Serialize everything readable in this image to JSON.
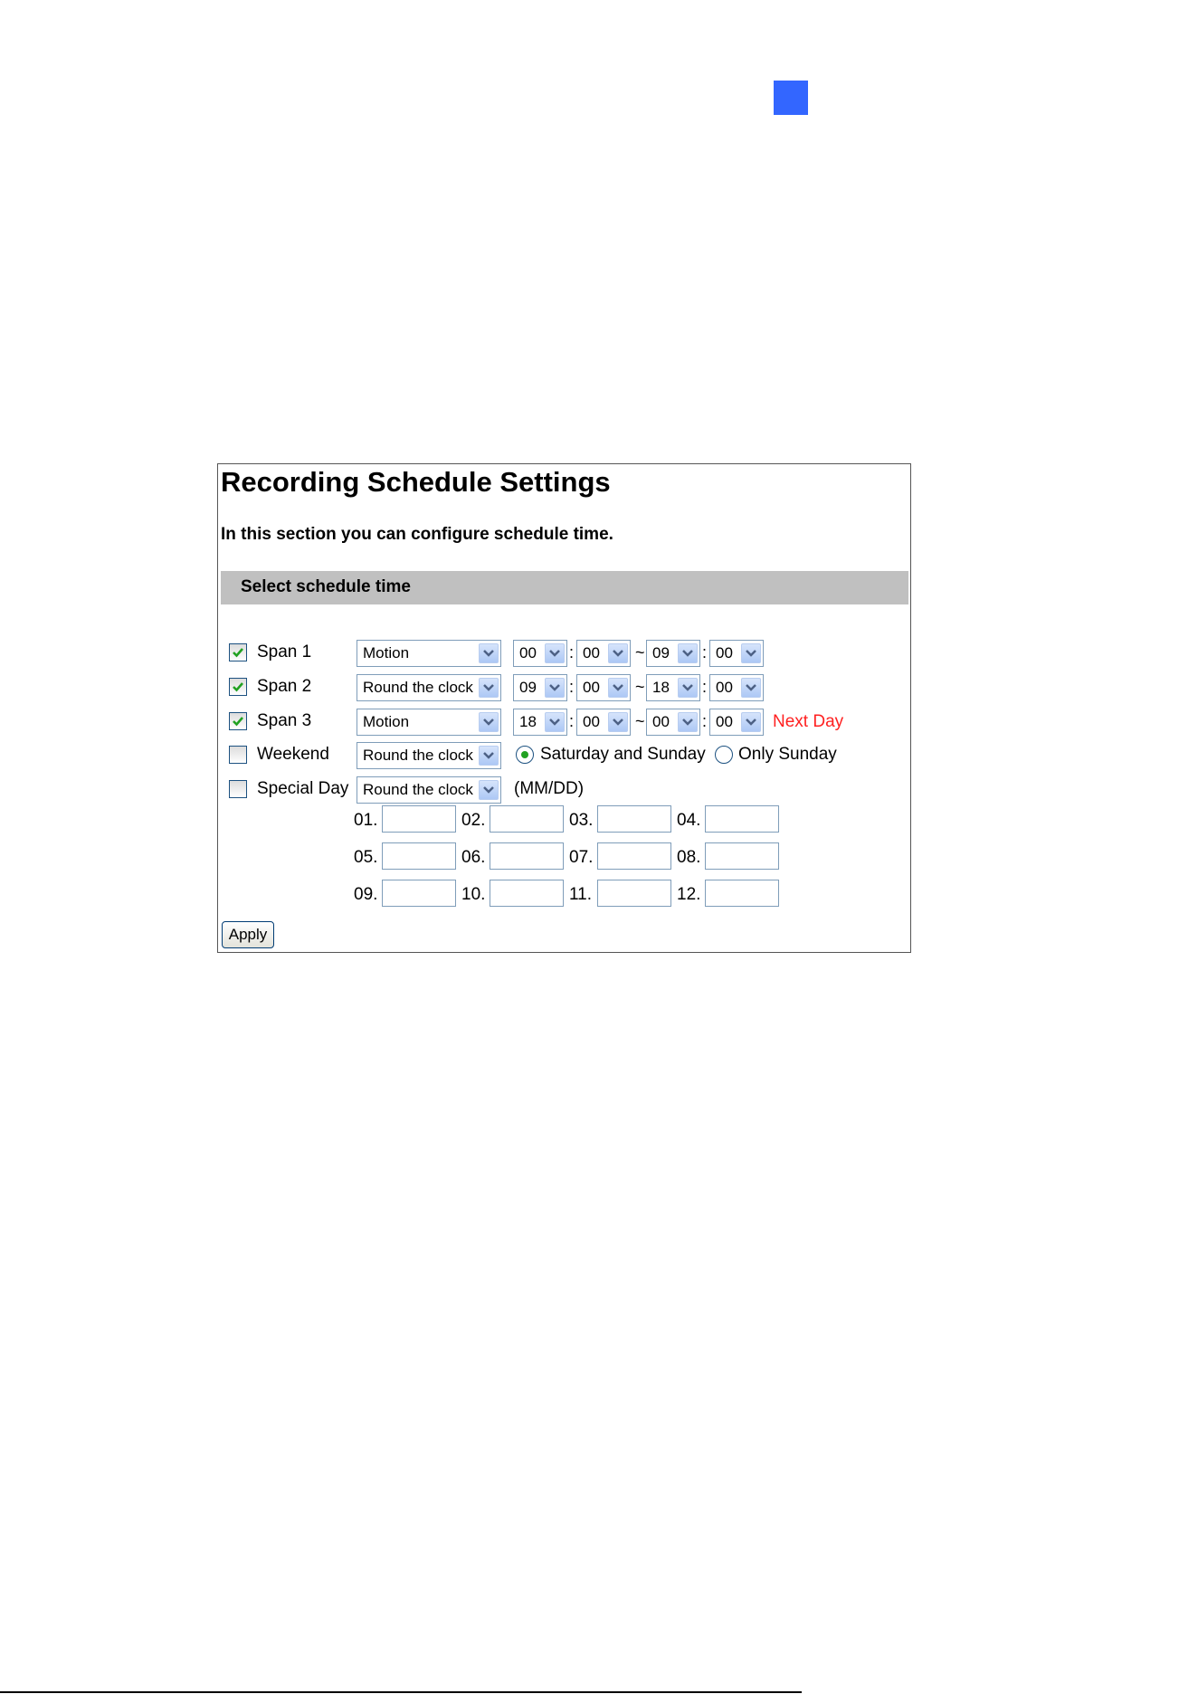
{
  "panel": {
    "title": "Recording Schedule Settings",
    "description": "In this section you can configure schedule time.",
    "section_header": "Select schedule time"
  },
  "spans": [
    {
      "label": "Span 1",
      "checked": true,
      "mode": "Motion",
      "start_h": "00",
      "start_m": "00",
      "end_h": "09",
      "end_m": "00",
      "note": ""
    },
    {
      "label": "Span 2",
      "checked": true,
      "mode": "Round the clock",
      "start_h": "09",
      "start_m": "00",
      "end_h": "18",
      "end_m": "00",
      "note": ""
    },
    {
      "label": "Span 3",
      "checked": true,
      "mode": "Motion",
      "start_h": "18",
      "start_m": "00",
      "end_h": "00",
      "end_m": "00",
      "note": "Next Day"
    }
  ],
  "separators": {
    "colon": ":",
    "tilde": "~"
  },
  "weekend": {
    "label": "Weekend",
    "checked": false,
    "mode": "Round the clock",
    "options": [
      "Saturday and Sunday",
      "Only Sunday"
    ],
    "selected": "Saturday and Sunday"
  },
  "special_day": {
    "label": "Special Day",
    "checked": false,
    "mode": "Round the clock",
    "format_hint": "(MM/DD)",
    "dates": [
      {
        "num": "01.",
        "value": ""
      },
      {
        "num": "02.",
        "value": ""
      },
      {
        "num": "03.",
        "value": ""
      },
      {
        "num": "04.",
        "value": ""
      },
      {
        "num": "05.",
        "value": ""
      },
      {
        "num": "06.",
        "value": ""
      },
      {
        "num": "07.",
        "value": ""
      },
      {
        "num": "08.",
        "value": ""
      },
      {
        "num": "09.",
        "value": ""
      },
      {
        "num": "10.",
        "value": ""
      },
      {
        "num": "11.",
        "value": ""
      },
      {
        "num": "12.",
        "value": ""
      }
    ]
  },
  "apply_label": "Apply",
  "colors": {
    "accent_marker": "#3366ff",
    "section_bar": "#c0c0c0",
    "next_day": "#ff2020",
    "check": "#21a121"
  }
}
